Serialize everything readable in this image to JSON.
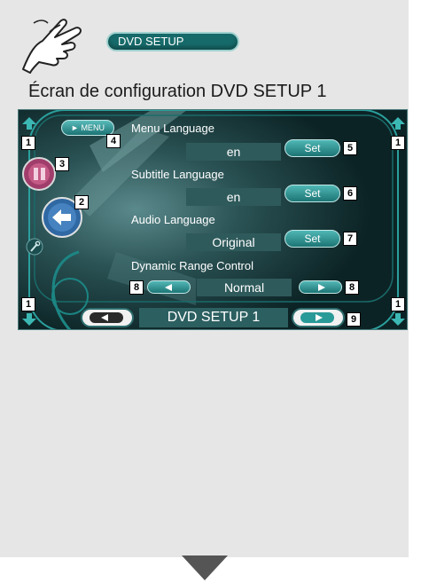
{
  "header": {
    "button_label": "DVD SETUP",
    "section_heading": "Écran de configuration DVD SETUP 1"
  },
  "screen": {
    "menu_button_label": "► MENU",
    "rows": [
      {
        "label": "Menu Language",
        "value": "en",
        "button": "Set",
        "callout": "5"
      },
      {
        "label": "Subtitle Language",
        "value": "en",
        "button": "Set",
        "callout": "6"
      },
      {
        "label": "Audio Language",
        "value": "Original",
        "button": "Set",
        "callout": "7"
      }
    ],
    "drc": {
      "label": "Dynamic Range Control",
      "value": "Normal",
      "callout": "8"
    },
    "footer_title": "DVD SETUP 1",
    "callouts": {
      "c1": "1",
      "c2": "2",
      "c3": "3",
      "c4": "4",
      "c9": "9"
    }
  },
  "colors": {
    "screen_bg": "#0d2a2c",
    "accent": "#2a9a98",
    "value_box": "#2f5a5b",
    "page_panel": "#e6e6e6"
  }
}
